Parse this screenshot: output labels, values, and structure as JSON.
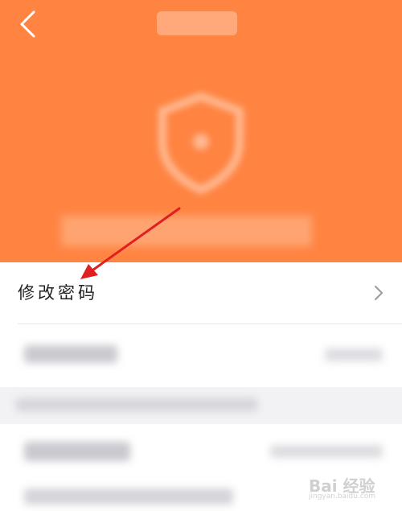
{
  "header": {
    "background_color": "#ff8442",
    "back_icon": "chevron-left-icon"
  },
  "menu": {
    "change_password_label": "修改密码",
    "chevron_icon": "chevron-right-icon"
  },
  "annotation": {
    "arrow_color": "#e02020"
  },
  "watermark": {
    "brand": "Bai 经验",
    "sub": "jingyan.baidu.com"
  }
}
